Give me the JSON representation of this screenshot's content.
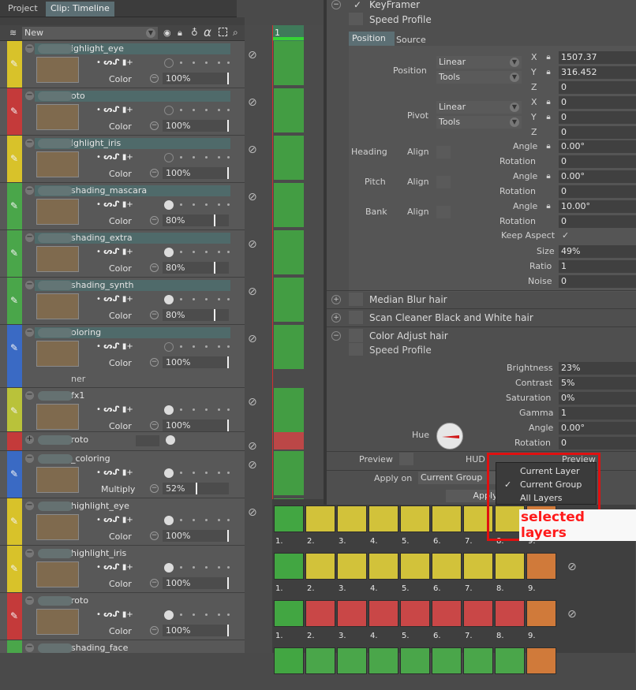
{
  "tabs": {
    "project": "Project",
    "clip": "Clip: Timeline"
  },
  "toolbar": {
    "new_label": "New"
  },
  "layers": [
    {
      "name": "ighlight_eye",
      "color": "#d8c22a",
      "blend": "Color",
      "opacity": "100%",
      "knob": "off"
    },
    {
      "name": "oto",
      "color": "#c43a3a",
      "blend": "Color",
      "opacity": "100%",
      "knob": "off"
    },
    {
      "name": "ighlight_iris",
      "color": "#d8c22a",
      "blend": "Color",
      "opacity": "100%",
      "knob": "off"
    },
    {
      "name": "shading_mascara",
      "color": "#4aa64a",
      "blend": "Color",
      "opacity": "80%",
      "knob": "on"
    },
    {
      "name": "shading_extra",
      "color": "#4aa64a",
      "blend": "Color",
      "opacity": "80%",
      "knob": "on"
    },
    {
      "name": "shading_synth",
      "color": "#4aa64a",
      "blend": "Color",
      "opacity": "80%",
      "knob": "on"
    },
    {
      "name": "oloring",
      "color": "#3a6ac4",
      "blend": "Color",
      "opacity": "100%",
      "knob": "off",
      "sub": "ner"
    },
    {
      "name": "fx1",
      "color": "#b9c23a",
      "blend": "Color",
      "opacity": "100%",
      "knob": "on"
    },
    {
      "name": "roto",
      "color": "#c43a3a",
      "blend": "",
      "opacity": "",
      "knob": "on"
    },
    {
      "name": "_coloring",
      "color": "#3a6ac4",
      "blend": "Multiply",
      "opacity": "52%",
      "knob": "on"
    },
    {
      "name": "highlight_eye",
      "color": "#d8c22a",
      "blend": "Color",
      "opacity": "100%",
      "knob": "on"
    },
    {
      "name": "highlight_iris",
      "color": "#d8c22a",
      "blend": "Color",
      "opacity": "100%",
      "knob": "on"
    },
    {
      "name": "roto",
      "color": "#c43a3a",
      "blend": "Color",
      "opacity": "100%",
      "knob": "on"
    },
    {
      "name": "shading_face",
      "color": "#4aa64a",
      "blend": "",
      "opacity": "",
      "knob": "on"
    }
  ],
  "timeline": {
    "frame": "1"
  },
  "keyframer": {
    "title": "KeyFramer",
    "speed_profile": "Speed Profile",
    "tab_position": "Position",
    "tab_source": "Source",
    "position_label": "Position",
    "pos_combo1": "Linear",
    "pos_combo2": "Tools",
    "pos_x": "1507.37",
    "pos_y": "316.452",
    "pos_z": "0",
    "pivot_label": "Pivot",
    "piv_combo1": "Linear",
    "piv_combo2": "Tools",
    "piv_x": "0",
    "piv_y": "0",
    "piv_z": "0",
    "heading": "Heading",
    "pitch": "Pitch",
    "bank": "Bank",
    "align": "Align",
    "angle": "Angle",
    "rotation": "Rotation",
    "head_angle": "0.00°",
    "head_rot": "0",
    "pitch_angle": "0.00°",
    "pitch_rot": "0",
    "bank_angle": "10.00°",
    "bank_rot": "0",
    "keep_aspect": "Keep Aspect",
    "size_label": "Size",
    "size": "49%",
    "ratio_label": "Ratio",
    "ratio": "1",
    "noise_label": "Noise",
    "noise": "0",
    "x": "X",
    "y": "Y",
    "z": "Z"
  },
  "sections": {
    "median": "Median Blur hair",
    "scan": "Scan Cleaner Black and White hair",
    "color_adjust": "Color Adjust hair",
    "speed_profile": "Speed Profile"
  },
  "color_adjust": {
    "brightness_label": "Brightness",
    "brightness": "23%",
    "contrast_label": "Contrast",
    "contrast": "5%",
    "saturation_label": "Saturation",
    "saturation": "0%",
    "gamma_label": "Gamma",
    "gamma": "1",
    "angle_label": "Angle",
    "angle": "0.00°",
    "rotation_label": "Rotation",
    "rotation": "0",
    "hue_label": "Hue"
  },
  "bottom": {
    "preview": "Preview",
    "hud": "HUD",
    "preview2": "Preview",
    "apply_on": "Apply on",
    "apply_value": "Current Group",
    "apply_btn": "Apply"
  },
  "popup": {
    "items": [
      "Current Layer",
      "Current Group",
      "All Layers"
    ],
    "checked": 1
  },
  "annotation": "selected layers",
  "segments": [
    "1.",
    "2.",
    "3.",
    "4.",
    "5.",
    "6.",
    "7.",
    "8.",
    "9."
  ]
}
